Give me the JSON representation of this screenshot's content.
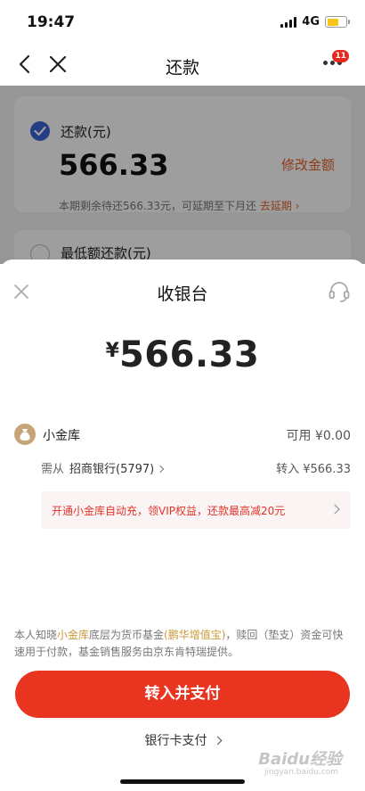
{
  "status": {
    "time": "19:47",
    "network": "4G"
  },
  "nav": {
    "title": "还款",
    "badge": "11"
  },
  "background": {
    "repay_label": "还款(元)",
    "repay_amount": "566.33",
    "modify_label": "修改金额",
    "note": "本期剩余待还566.33元，可延期至下月还",
    "note_link": "去延期",
    "min_label": "最低额还款(元)"
  },
  "cashier": {
    "title": "收银台",
    "currency": "¥",
    "amount": "566.33",
    "wallet": {
      "label": "小金库",
      "available": "可用 ¥0.00"
    },
    "source": {
      "prefix": "需从",
      "bank": "招商银行(5797)",
      "transfer": "转入 ¥566.33"
    },
    "promo": "开通小金库自动充，领VIP权益，还款最高减20元",
    "disclaimer": {
      "p1": "本人知晓",
      "hl1": "小金库",
      "p2": "底层为货币基金",
      "hl2": "(鹏华增值宝)",
      "p3": "，赎回（垫支）资金可快速用于付款，基金销售服务由京东肯特瑞提供。"
    },
    "pay_button": "转入并支付",
    "card_pay": "银行卡支付"
  },
  "watermark": {
    "text": "Baidu经验",
    "sub": "jingyan.baidu.com"
  },
  "colors": {
    "accent": "#e9341f",
    "check_blue": "#3b64d8",
    "link_orange": "#e0632b",
    "gold": "#c99a3a"
  }
}
